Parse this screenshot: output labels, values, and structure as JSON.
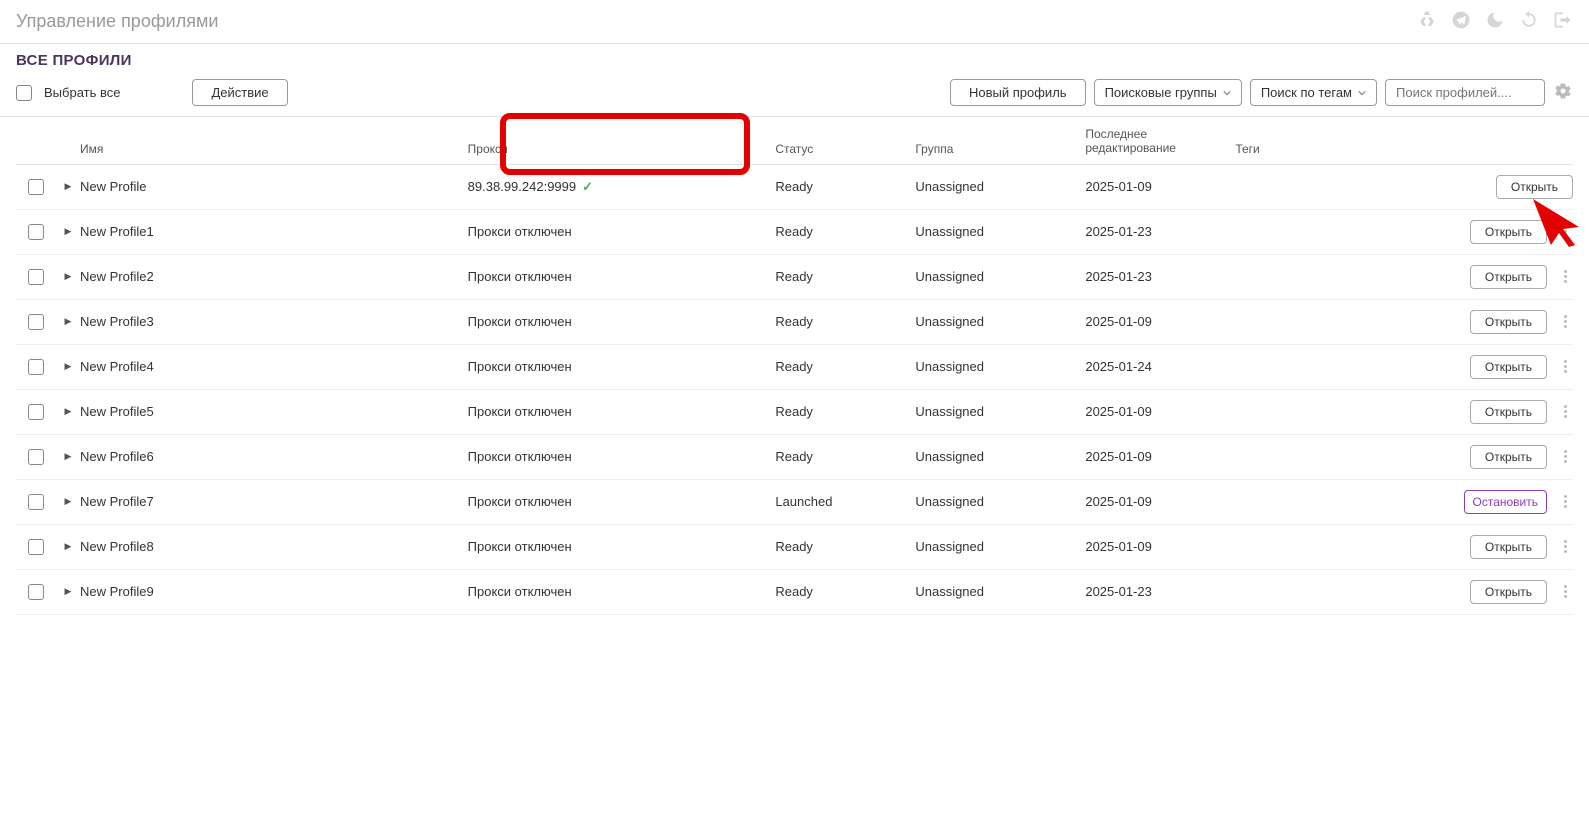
{
  "page_title": "Управление профилями",
  "sub_title": "ВСЕ ПРОФИЛИ",
  "toolbar": {
    "select_all": "Выбрать все",
    "action": "Действие",
    "new_profile": "Новый профиль",
    "search_groups": "Поисковые группы",
    "search_tags": "Поиск по тегам",
    "search_profiles_placeholder": "Поиск профилей...."
  },
  "columns": {
    "name": "Имя",
    "proxy": "Прокси",
    "status": "Статус",
    "group": "Группа",
    "last_edit": "Последнее редактирование",
    "tags": "Теги"
  },
  "buttons": {
    "open": "Открыть",
    "stop": "Остановить"
  },
  "proxy_off_label": "Прокси отключен",
  "rows": [
    {
      "name": "New Profile",
      "proxy": "89.38.99.242:9999",
      "proxy_ok": true,
      "status": "Ready",
      "group": "Unassigned",
      "last": "2025-01-09",
      "action": "open",
      "kebab": false
    },
    {
      "name": "New Profile1",
      "proxy": "Прокси отключен",
      "proxy_ok": false,
      "status": "Ready",
      "group": "Unassigned",
      "last": "2025-01-23",
      "action": "open",
      "kebab": true
    },
    {
      "name": "New Profile2",
      "proxy": "Прокси отключен",
      "proxy_ok": false,
      "status": "Ready",
      "group": "Unassigned",
      "last": "2025-01-23",
      "action": "open",
      "kebab": true
    },
    {
      "name": "New Profile3",
      "proxy": "Прокси отключен",
      "proxy_ok": false,
      "status": "Ready",
      "group": "Unassigned",
      "last": "2025-01-09",
      "action": "open",
      "kebab": true
    },
    {
      "name": "New Profile4",
      "proxy": "Прокси отключен",
      "proxy_ok": false,
      "status": "Ready",
      "group": "Unassigned",
      "last": "2025-01-24",
      "action": "open",
      "kebab": true
    },
    {
      "name": "New Profile5",
      "proxy": "Прокси отключен",
      "proxy_ok": false,
      "status": "Ready",
      "group": "Unassigned",
      "last": "2025-01-09",
      "action": "open",
      "kebab": true
    },
    {
      "name": "New Profile6",
      "proxy": "Прокси отключен",
      "proxy_ok": false,
      "status": "Ready",
      "group": "Unassigned",
      "last": "2025-01-09",
      "action": "open",
      "kebab": true
    },
    {
      "name": "New Profile7",
      "proxy": "Прокси отключен",
      "proxy_ok": false,
      "status": "Launched",
      "group": "Unassigned",
      "last": "2025-01-09",
      "action": "stop",
      "kebab": true
    },
    {
      "name": "New Profile8",
      "proxy": "Прокси отключен",
      "proxy_ok": false,
      "status": "Ready",
      "group": "Unassigned",
      "last": "2025-01-09",
      "action": "open",
      "kebab": true
    },
    {
      "name": "New Profile9",
      "proxy": "Прокси отключен",
      "proxy_ok": false,
      "status": "Ready",
      "group": "Unassigned",
      "last": "2025-01-23",
      "action": "open",
      "kebab": true
    }
  ]
}
